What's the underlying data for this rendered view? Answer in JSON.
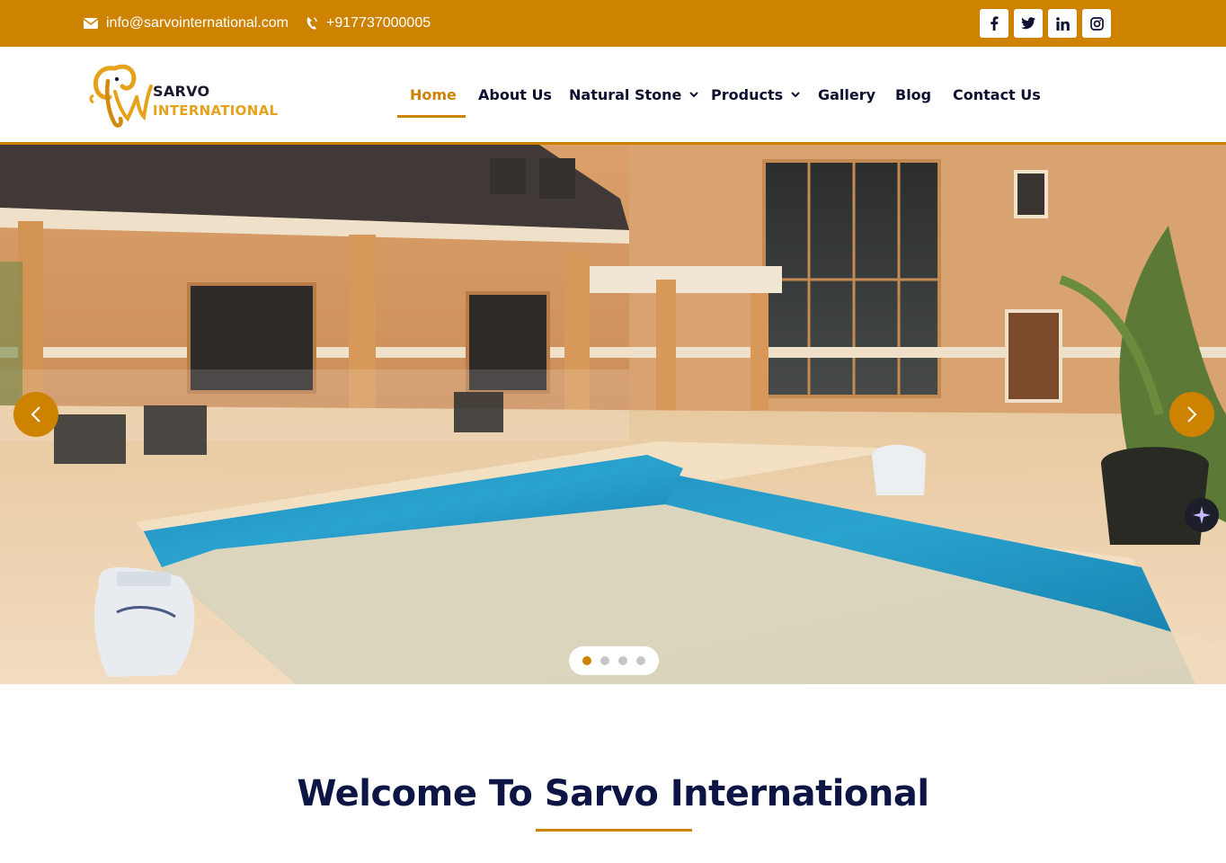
{
  "topbar": {
    "email": "info@sarvointernational.com",
    "phone": "+917737000005",
    "social": [
      "facebook-icon",
      "twitter-icon",
      "linkedin-icon",
      "instagram-icon"
    ]
  },
  "brand": {
    "line1": "SARVO",
    "line2": "INTERNATIONAL"
  },
  "nav": {
    "items": [
      {
        "label": "Home",
        "active": true
      },
      {
        "label": "About Us"
      },
      {
        "label": "Natural Stone",
        "dropdown": true
      },
      {
        "label": "Products",
        "dropdown": true
      },
      {
        "label": "Gallery"
      },
      {
        "label": "Blog"
      },
      {
        "label": "Contact Us"
      }
    ]
  },
  "slider": {
    "slides": 4,
    "current": 1
  },
  "welcome": {
    "title": "Welcome To Sarvo International"
  },
  "colors": {
    "accent": "#cd8300",
    "navy": "#0d1545",
    "text": "#0d1030"
  }
}
